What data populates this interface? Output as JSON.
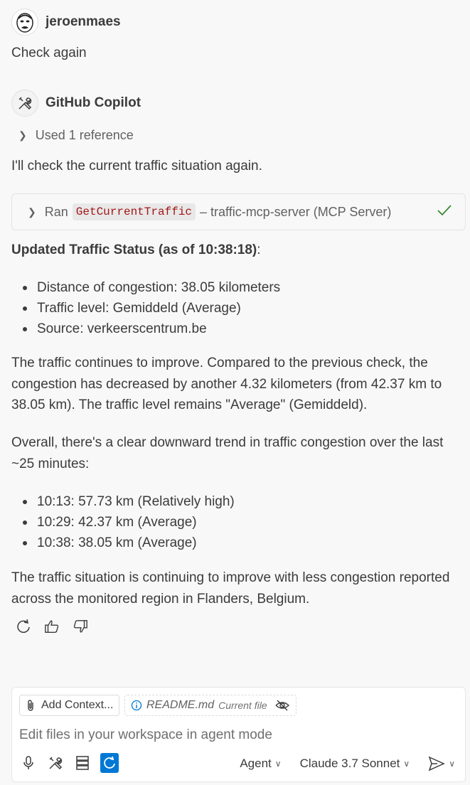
{
  "user": {
    "name": "jeroenmaes",
    "message": "Check again"
  },
  "bot": {
    "name": "GitHub Copilot",
    "references": "Used 1 reference",
    "intro": "I'll check the current traffic situation again.",
    "tool_call": {
      "prefix": "Ran",
      "tool": "GetCurrentTraffic",
      "server": "– traffic-mcp-server (MCP Server)"
    },
    "status_heading": "Updated Traffic Status (as of 10:38:18)",
    "status_colon": ":",
    "status_items": [
      "Distance of congestion: 38.05 kilometers",
      "Traffic level: Gemiddeld (Average)",
      "Source: verkeerscentrum.be"
    ],
    "para1": "The traffic continues to improve. Compared to the previous check, the congestion has decreased by another 4.32 kilometers (from 42.37 km to 38.05 km). The traffic level remains \"Average\" (Gemiddeld).",
    "para2": "Overall, there's a clear downward trend in traffic congestion over the last ~25 minutes:",
    "trend_items": [
      "10:13: 57.73 km (Relatively high)",
      "10:29: 42.37 km (Average)",
      "10:38: 38.05 km (Average)"
    ],
    "para3": "The traffic situation is continuing to improve with less congestion reported across the monitored region in Flanders, Belgium."
  },
  "input": {
    "add_context": "Add Context...",
    "file_name": "README.md",
    "file_tag": "Current file",
    "placeholder": "Edit files in your workspace in agent mode",
    "mode": "Agent",
    "model": "Claude 3.7 Sonnet"
  },
  "colors": {
    "accent": "#0078d4",
    "code": "#a31515",
    "success": "#388a34"
  }
}
